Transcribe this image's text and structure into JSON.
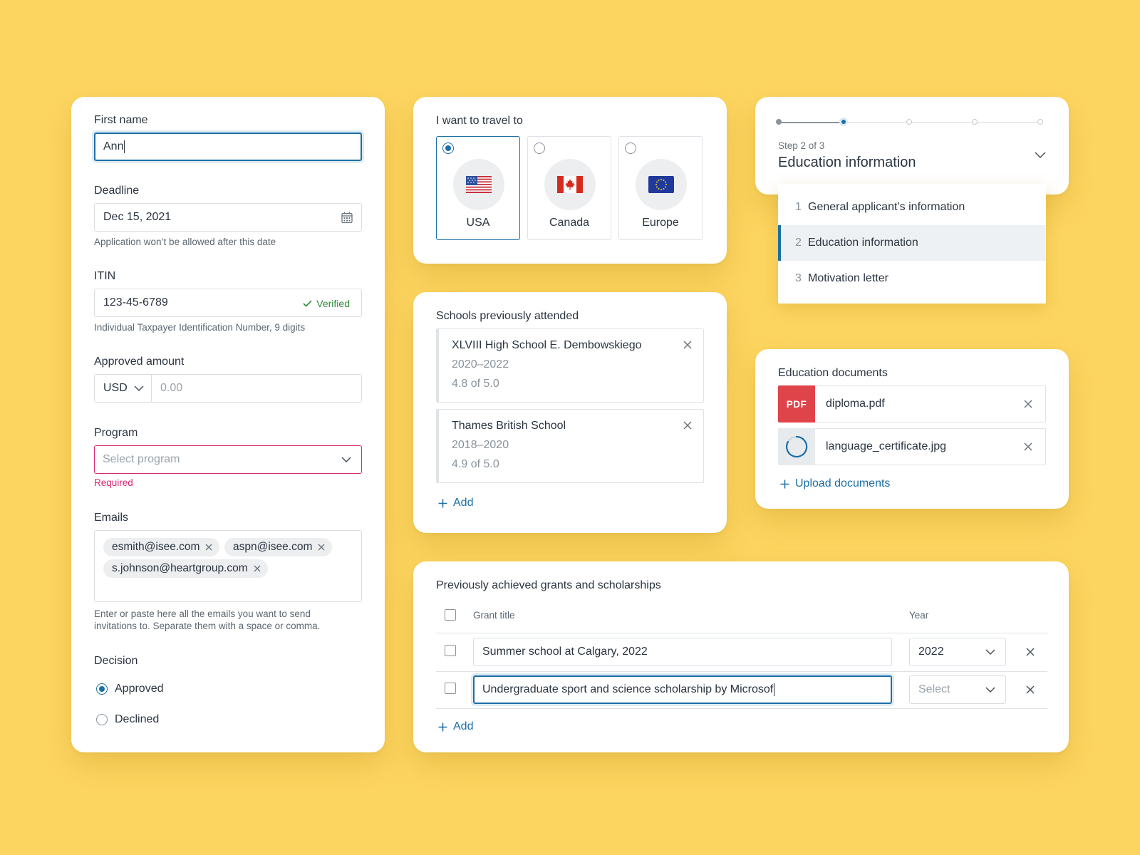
{
  "form": {
    "first_name_label": "First name",
    "first_name_value": "Ann",
    "deadline_label": "Deadline",
    "deadline_value": "Dec 15, 2021",
    "deadline_hint": "Application won’t be allowed after this date",
    "itin_label": "ITIN",
    "itin_value": "123-45-6789",
    "itin_status": "Verified",
    "itin_hint": "Individual Taxpayer Identification Number, 9 digits",
    "amount_label": "Approved amount",
    "amount_currency": "USD",
    "amount_placeholder": "0.00",
    "program_label": "Program",
    "program_placeholder": "Select program",
    "program_error": "Required",
    "emails_label": "Emails",
    "emails": [
      "esmith@isee.com",
      "aspn@isee.com",
      "s.johnson@heartgroup.com"
    ],
    "emails_hint_line1": "Enter or paste here all the emails you want to send",
    "emails_hint_line2": "invitations to. Separate them with a space or comma.",
    "decision_label": "Decision",
    "decision_options": [
      "Approved",
      "Declined"
    ],
    "decision_selected": "Approved"
  },
  "travel": {
    "label": "I want to travel to",
    "options": [
      "USA",
      "Canada",
      "Europe"
    ],
    "selected": "USA"
  },
  "schools": {
    "label": "Schools previously attended",
    "items": [
      {
        "name": "XLVIII High School E. Dembowskiego",
        "years": "2020–2022",
        "grade": "4.8 of 5.0"
      },
      {
        "name": "Thames British School",
        "years": "2018–2020",
        "grade": "4.9 of 5.0"
      }
    ],
    "add_label": "Add"
  },
  "stepper": {
    "step_text": "Step 2 of 3",
    "title": "Education information",
    "current_dot": 2,
    "dot_count": 5,
    "items": [
      {
        "num": "1",
        "label": "General applicant’s information"
      },
      {
        "num": "2",
        "label": "Education information"
      },
      {
        "num": "3",
        "label": "Motivation letter"
      }
    ]
  },
  "documents": {
    "label": "Education documents",
    "files": [
      {
        "badge": "PDF",
        "name": "diploma.pdf"
      },
      {
        "badge": "",
        "name": "language_certificate.jpg"
      }
    ],
    "upload_label": "Upload documents"
  },
  "grants": {
    "label": "Previously achieved grants and scholarships",
    "col_title": "Grant title",
    "col_year": "Year",
    "rows": [
      {
        "title": "Summer school at Calgary, 2022",
        "year": "2022"
      },
      {
        "title": "Undergraduate sport and science scholarship by Microsof",
        "year": ""
      }
    ],
    "year_placeholder": "Select",
    "add_label": "Add"
  },
  "colors": {
    "background": "#FCD560",
    "accent": "#1c6fa6",
    "error": "#d6286f",
    "success": "#2e8b3a",
    "pdf_badge": "#e0444b"
  }
}
